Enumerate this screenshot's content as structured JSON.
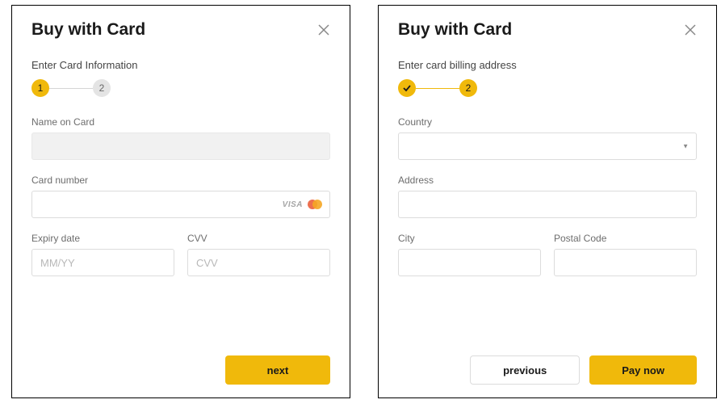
{
  "colors": {
    "accent": "#f0b90b",
    "inactive": "#e4e4e4"
  },
  "modalLeft": {
    "title": "Buy with Card",
    "sectionLabel": "Enter Card Information",
    "step1": "1",
    "step2": "2",
    "fields": {
      "nameLabel": "Name on Card",
      "cardNumberLabel": "Card number",
      "expiryLabel": "Expiry date",
      "expiryPlaceholder": "MM/YY",
      "cvvLabel": "CVV",
      "cvvPlaceholder": "CVV",
      "visa": "VISA"
    },
    "nextButton": "next"
  },
  "modalRight": {
    "title": "Buy with Card",
    "sectionLabel": "Enter card billing address",
    "step2": "2",
    "fields": {
      "countryLabel": "Country",
      "addressLabel": "Address",
      "cityLabel": "City",
      "postalLabel": "Postal Code"
    },
    "previousButton": "previous",
    "payButton": "Pay now"
  }
}
